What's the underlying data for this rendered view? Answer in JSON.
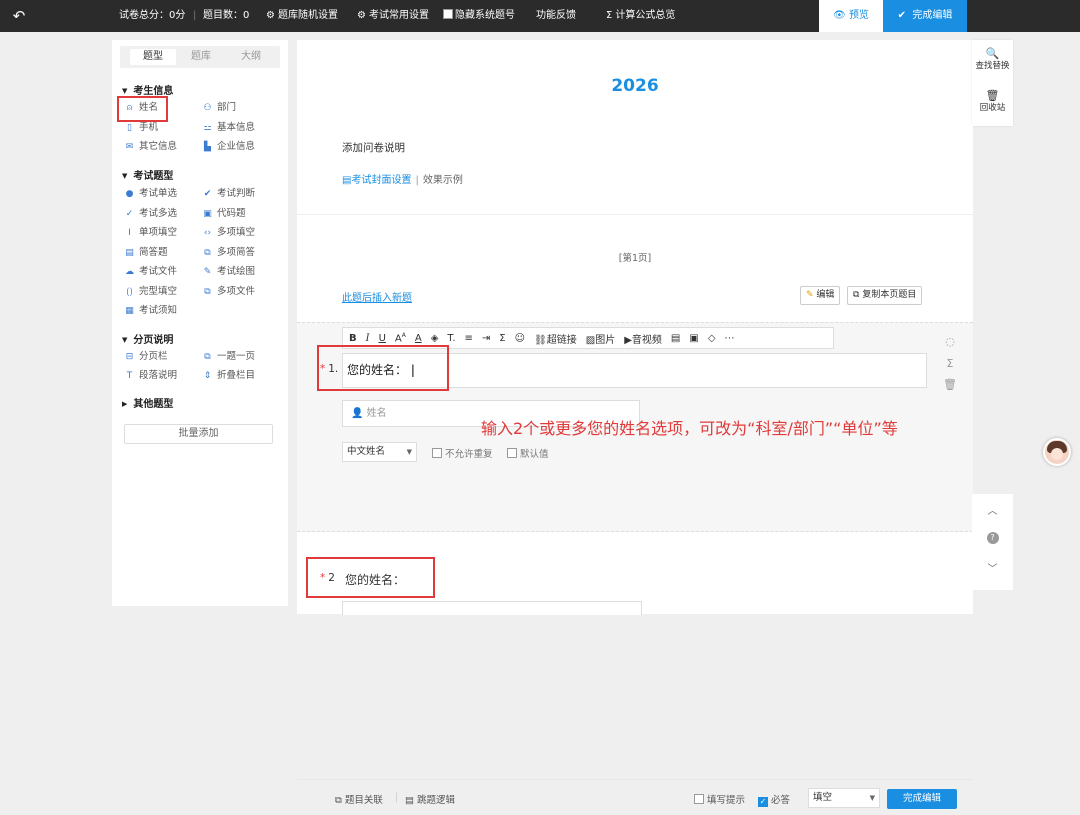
{
  "topbar": {
    "total_score": "试卷总分：0分",
    "question_count": "题目数：0",
    "random_settings": "题库随机设置",
    "common_settings": "考试常用设置",
    "hide_numbers": "隐藏系统题号",
    "feedback": "功能反馈",
    "formula": "计算公式总览",
    "preview": "预览",
    "done": "完成编辑"
  },
  "left": {
    "tabs": [
      "题型",
      "题库",
      "大纲"
    ],
    "sections": {
      "candidate": {
        "title": "考生信息",
        "items": [
          "姓名",
          "部门",
          "手机",
          "基本信息",
          "其它信息",
          "企业信息"
        ]
      },
      "exam": {
        "title": "考试题型",
        "items": [
          "考试单选",
          "考试判断",
          "考试多选",
          "代码题",
          "单项填空",
          "多项填空",
          "简答题",
          "多项简答",
          "考试文件",
          "考试绘图",
          "完型填空",
          "多项文件",
          "考试须知"
        ]
      },
      "page": {
        "title": "分页说明",
        "items": [
          "分页栏",
          "一题一页",
          "段落说明",
          "折叠栏目"
        ]
      },
      "other": {
        "title": "其他题型"
      }
    },
    "batch_add": "批量添加"
  },
  "main": {
    "title": "2026",
    "description": "添加问卷说明",
    "cover_settings": "考试封面设置",
    "effect_example": "效果示例",
    "page_label": "[第1页]",
    "insert_new": "此题后插入新题",
    "edit_btn": "编辑",
    "copy_btn": "复制本页题目",
    "toolbar": {
      "link": "超链接",
      "image": "图片",
      "video": "音视频"
    },
    "q1": {
      "number": "1.",
      "text": "您的姓名：",
      "placeholder": "姓名",
      "name_type": "中文姓名",
      "no_repeat": "不允许重复",
      "default_value": "默认值",
      "related": "题目关联",
      "logic": "跳题逻辑",
      "hint": "填写提示",
      "required": "必答",
      "fill_type": "填空",
      "finish": "完成编辑"
    },
    "q2": {
      "number": "2",
      "text": "您的姓名："
    },
    "annotation": "输入2个或更多您的姓名选项，可改为“科室/部门”“单位”等"
  },
  "right": {
    "find_replace": "查找替换",
    "recycle": "回收站"
  }
}
